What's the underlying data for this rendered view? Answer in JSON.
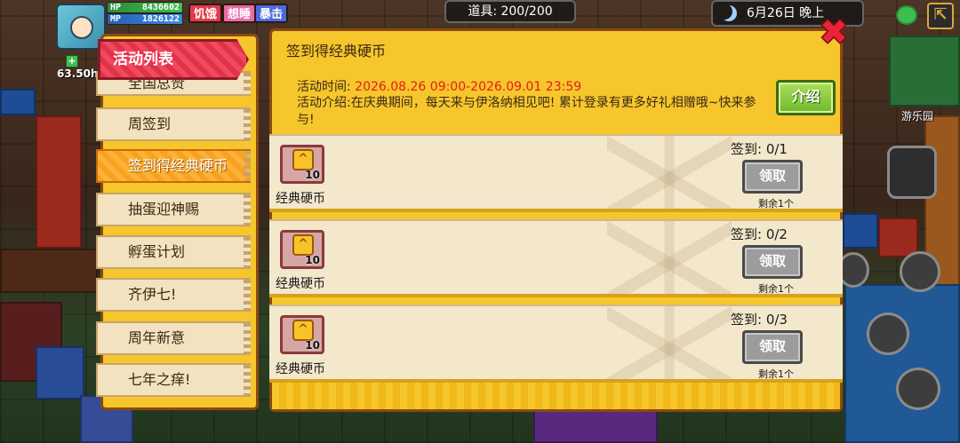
{
  "hud": {
    "hp_label": "HP",
    "hp_value": "8436602",
    "mp_label": "MP",
    "mp_value": "1826122",
    "status_buttons": [
      {
        "label": "饥饿",
        "color": "#e23a4a"
      },
      {
        "label": "想睡",
        "color": "#e86aa8"
      },
      {
        "label": "暴击",
        "color": "#4a6ae0"
      }
    ],
    "timer": "63.50h",
    "items_label": "道具: 200/200",
    "date_label": "6月26日  晚上",
    "location_label": "游乐园"
  },
  "sidebar": {
    "title": "活动列表",
    "items": [
      {
        "label": "全国总赞",
        "active": false
      },
      {
        "label": "周签到",
        "active": false
      },
      {
        "label": "签到得经典硬币",
        "active": true
      },
      {
        "label": "抽蛋迎神赐",
        "active": false
      },
      {
        "label": "孵蛋计划",
        "active": false
      },
      {
        "label": "齐伊七!",
        "active": false
      },
      {
        "label": "周年新意",
        "active": false
      },
      {
        "label": "七年之痒!",
        "active": false
      }
    ]
  },
  "main": {
    "title": "签到得经典硬币",
    "time_label": "活动时间:",
    "time_value": "2026.08.26 09:00-2026.09.01 23:59",
    "desc_label": "活动介绍:",
    "desc_value": "在庆典期间，每天来与伊洛纳相见吧! 累计登录有更多好礼相赠哦~快来参与!",
    "intro_button": "介绍",
    "close_icon": "close-icon",
    "rewards": [
      {
        "item_name": "经典硬币",
        "quantity": "10",
        "progress": "签到: 0/1",
        "claim_label": "领取",
        "remaining": "剩余1个"
      },
      {
        "item_name": "经典硬币",
        "quantity": "10",
        "progress": "签到: 0/2",
        "claim_label": "领取",
        "remaining": "剩余1个"
      },
      {
        "item_name": "经典硬币",
        "quantity": "10",
        "progress": "签到: 0/3",
        "claim_label": "领取",
        "remaining": "剩余1个"
      }
    ]
  },
  "colors": {
    "panel_yellow": "#f6c62c",
    "panel_border": "#8a4a10",
    "header_red": "#e0334a",
    "active_orange": "#f8a21e",
    "highlight_red": "#e21b1b",
    "intro_green": "#6fb92c",
    "claim_gray": "#9c9c9c"
  }
}
